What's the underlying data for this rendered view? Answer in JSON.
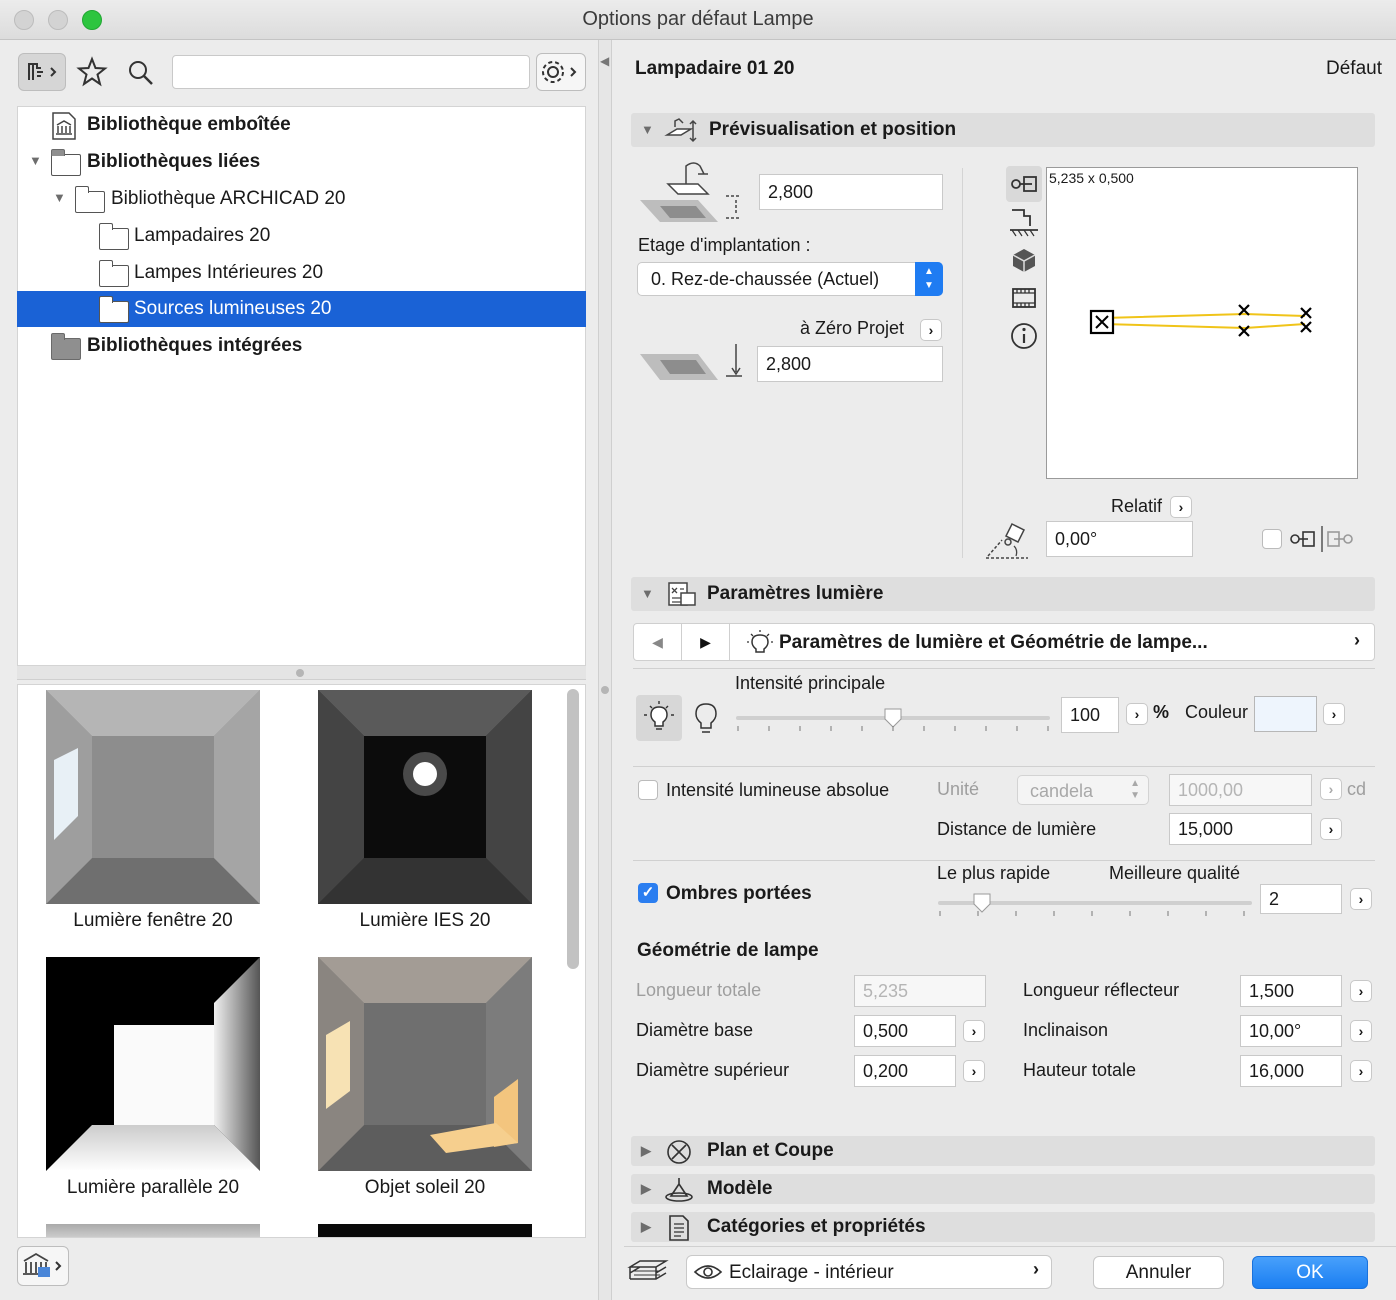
{
  "window": {
    "title": "Options par défaut Lampe"
  },
  "left": {
    "search_placeholder": "",
    "tree": [
      {
        "label": "Bibliothèque emboîtée"
      },
      {
        "label": "Bibliothèques liées"
      },
      {
        "label": "Bibliothèque ARCHICAD 20"
      },
      {
        "label": "Lampadaires 20"
      },
      {
        "label": "Lampes Intérieures 20"
      },
      {
        "label": "Sources lumineuses 20"
      },
      {
        "label": "Bibliothèques intégrées"
      }
    ],
    "thumbs": [
      {
        "label": "Lumière fenêtre 20"
      },
      {
        "label": "Lumière IES 20"
      },
      {
        "label": "Lumière parallèle 20"
      },
      {
        "label": "Objet soleil 20"
      }
    ]
  },
  "right": {
    "object_name": "Lampadaire 01 20",
    "default_label": "Défaut",
    "preview": {
      "header": "Prévisualisation et position",
      "height_value": "2,800",
      "story_label": "Etage d'implantation :",
      "story_value": "0. Rez-de-chaussée (Actuel)",
      "zero_label": "à Zéro Projet",
      "zero_value": "2,800",
      "dimensions": "5,235 x 0,500",
      "relative_label": "Relatif",
      "angle_value": "0,00°"
    },
    "light": {
      "header": "Paramètres lumière",
      "nav_title": "Paramètres de lumière et Géométrie de lampe...",
      "intensity_label": "Intensité principale",
      "intensity_value": "100",
      "intensity_fraction": 0.5,
      "percent": "%",
      "color_label": "Couleur",
      "absolute_label": "Intensité lumineuse absolue",
      "unit_label": "Unité",
      "unit_value": "candela",
      "absolute_value": "1000,00",
      "cd": "cd",
      "distance_label": "Distance de lumière",
      "distance_value": "15,000",
      "shadows_label": "Ombres portées",
      "fast_label": "Le plus rapide",
      "quality_label": "Meilleure qualité",
      "quality_value": "2",
      "quality_fraction": 0.14,
      "geometry_label": "Géométrie de lampe",
      "total_length_label": "Longueur totale",
      "total_length_value": "5,235",
      "base_diam_label": "Diamètre base",
      "base_diam_value": "0,500",
      "top_diam_label": "Diamètre supérieur",
      "top_diam_value": "0,200",
      "reflector_label": "Longueur réflecteur",
      "reflector_value": "1,500",
      "tilt_label": "Inclinaison",
      "tilt_value": "10,00°",
      "height_label": "Hauteur totale",
      "height_value": "16,000"
    },
    "sections": [
      {
        "label": "Plan et Coupe"
      },
      {
        "label": "Modèle"
      },
      {
        "label": "Catégories et propriétés"
      }
    ],
    "footer": {
      "layer_value": "Eclairage - intérieur",
      "cancel": "Annuler",
      "ok": "OK"
    }
  },
  "colors": {
    "selection": "#1a62d6",
    "ok_button": "#1f8bf5",
    "checkbox": "#2b7ef0"
  }
}
